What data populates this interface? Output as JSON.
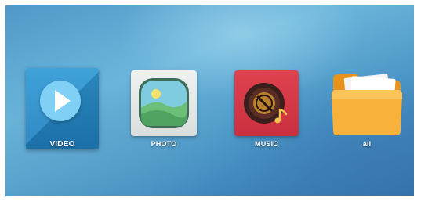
{
  "launcher": {
    "apps": [
      {
        "label": "VIDEO",
        "icon": "play-icon",
        "color": "#2f9ad6"
      },
      {
        "label": "PHOTO",
        "icon": "photo-icon",
        "color": "#e6ebe9"
      },
      {
        "label": "MUSIC",
        "icon": "music-icon",
        "color": "#d8394a"
      },
      {
        "label": "all",
        "icon": "folder-icon",
        "color": "#f6a623"
      }
    ]
  }
}
